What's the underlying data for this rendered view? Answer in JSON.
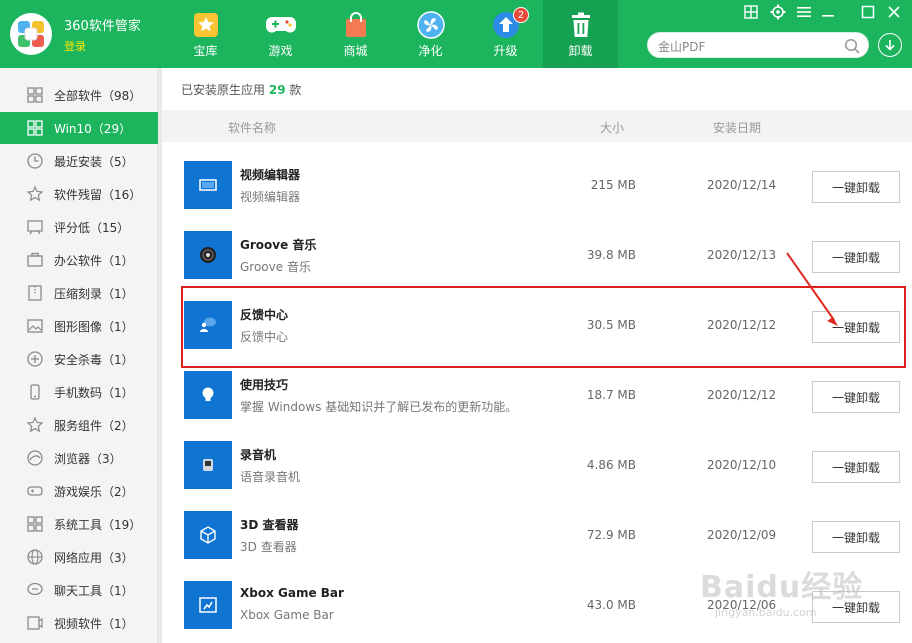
{
  "header": {
    "app_title": "360软件管家",
    "login_label": "登录",
    "nav": [
      {
        "label": "宝库",
        "icon": "star-icon"
      },
      {
        "label": "游戏",
        "icon": "gamepad-icon"
      },
      {
        "label": "商城",
        "icon": "shopping-bag-icon"
      },
      {
        "label": "净化",
        "icon": "fan-icon"
      },
      {
        "label": "升级",
        "icon": "upgrade-arrow-icon",
        "badge": "2"
      },
      {
        "label": "卸载",
        "icon": "trash-icon",
        "active": true
      }
    ],
    "search_value": "金山PDF"
  },
  "sidebar": {
    "items": [
      {
        "label": "全部软件（98）",
        "icon": "grid-icon"
      },
      {
        "label": "Win10（29）",
        "icon": "windows-icon",
        "active": true
      },
      {
        "label": "最近安装（5）",
        "icon": "clock-icon"
      },
      {
        "label": "软件残留（16）",
        "icon": "star-outline-icon"
      },
      {
        "label": "评分低（15）",
        "icon": "rating-icon"
      },
      {
        "label": "办公软件（1）",
        "icon": "briefcase-icon"
      },
      {
        "label": "压缩刻录（1）",
        "icon": "archive-icon"
      },
      {
        "label": "图形图像（1）",
        "icon": "image-icon"
      },
      {
        "label": "安全杀毒（1）",
        "icon": "shield-icon"
      },
      {
        "label": "手机数码（1）",
        "icon": "phone-icon"
      },
      {
        "label": "服务组件（2）",
        "icon": "component-icon"
      },
      {
        "label": "浏览器（3）",
        "icon": "browser-icon"
      },
      {
        "label": "游戏娱乐（2）",
        "icon": "game-icon"
      },
      {
        "label": "系统工具（19）",
        "icon": "tools-icon"
      },
      {
        "label": "网络应用（3）",
        "icon": "globe-icon"
      },
      {
        "label": "聊天工具（1）",
        "icon": "chat-icon"
      },
      {
        "label": "视频软件（1）",
        "icon": "video-icon"
      }
    ]
  },
  "main": {
    "summary_prefix": "已安装原生应用",
    "summary_count": "29",
    "summary_suffix": "款",
    "columns": {
      "name": "软件名称",
      "size": "大小",
      "date": "安装日期"
    },
    "uninstall_label": "一键卸载",
    "apps": [
      {
        "name": "视频编辑器",
        "desc": "视频编辑器",
        "size": "215 MB",
        "date": "2020/12/14",
        "icon": "video-editor-icon"
      },
      {
        "name": "Groove 音乐",
        "desc": "Groove 音乐",
        "size": "39.8 MB",
        "date": "2020/12/13",
        "icon": "music-disc-icon"
      },
      {
        "name": "反馈中心",
        "desc": "反馈中心",
        "size": "30.5 MB",
        "date": "2020/12/12",
        "icon": "feedback-icon"
      },
      {
        "name": "使用技巧",
        "desc": "掌握 Windows 基础知识并了解已发布的更新功能。",
        "size": "18.7 MB",
        "date": "2020/12/12",
        "icon": "lightbulb-icon"
      },
      {
        "name": "录音机",
        "desc": "语音录音机",
        "size": "4.86 MB",
        "date": "2020/12/10",
        "icon": "microphone-icon"
      },
      {
        "name": "3D 查看器",
        "desc": "3D 查看器",
        "size": "72.9 MB",
        "date": "2020/12/09",
        "icon": "cube-icon"
      },
      {
        "name": "Xbox Game Bar",
        "desc": "Xbox Game Bar",
        "size": "43.0 MB",
        "date": "2020/12/06",
        "icon": "game-bar-icon"
      }
    ]
  },
  "watermark": {
    "text": "Baidu经验",
    "sub": "jingyan.baidu.com"
  },
  "colors": {
    "brand": "#1cb55e",
    "app_tile": "#0f74d2",
    "highlight": "#d9201c"
  }
}
